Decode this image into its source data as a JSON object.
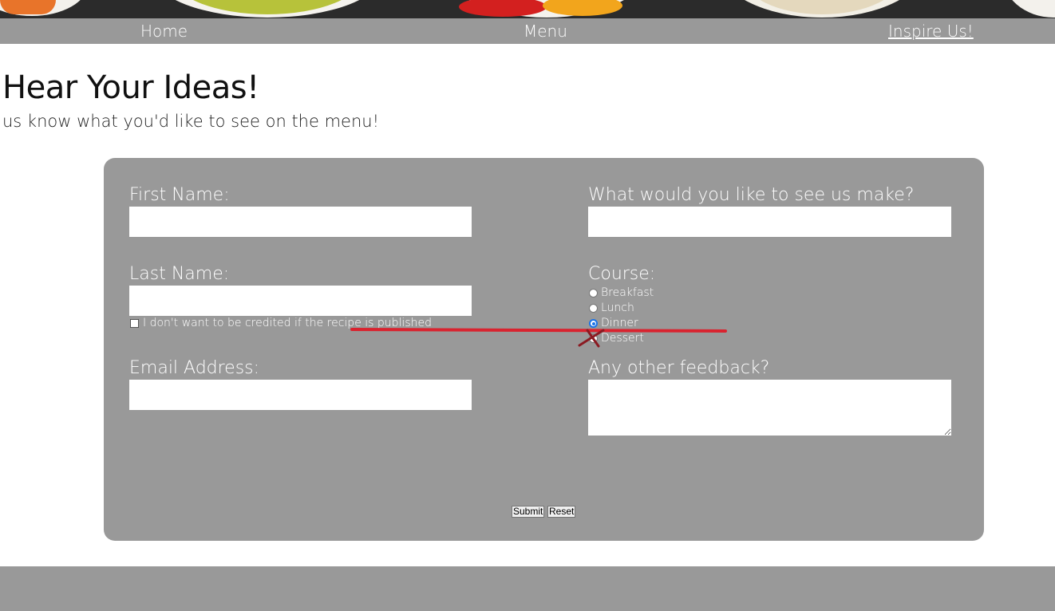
{
  "nav": {
    "items": [
      {
        "label": "Home"
      },
      {
        "label": "Menu"
      },
      {
        "label": "Inspire Us!",
        "active": true
      }
    ]
  },
  "page": {
    "title": "Hear Your Ideas!",
    "subtitle": "us know what you'd like to see on the menu!"
  },
  "form": {
    "first_name_label": "First Name:",
    "first_name_value": "",
    "last_name_label": "Last Name:",
    "last_name_value": "",
    "credit_checkbox_label": "I don't want to be credited if the recipe is published",
    "credit_checkbox_checked": false,
    "email_label": "Email Address:",
    "email_value": "",
    "make_label": "What would you like to see us make?",
    "make_value": "",
    "course_label": "Course:",
    "course_options": [
      {
        "label": "Breakfast",
        "checked": false
      },
      {
        "label": "Lunch",
        "checked": false
      },
      {
        "label": "Dinner",
        "checked": true
      },
      {
        "label": "Dessert",
        "checked": false
      }
    ],
    "feedback_label": "Any other feedback?",
    "feedback_value": "",
    "submit_label": "Submit",
    "reset_label": "Reset"
  },
  "colors": {
    "panel": "#999999",
    "nav": "#999999",
    "annotation": "#d9232f",
    "radio_selected": "#1a73e8"
  }
}
